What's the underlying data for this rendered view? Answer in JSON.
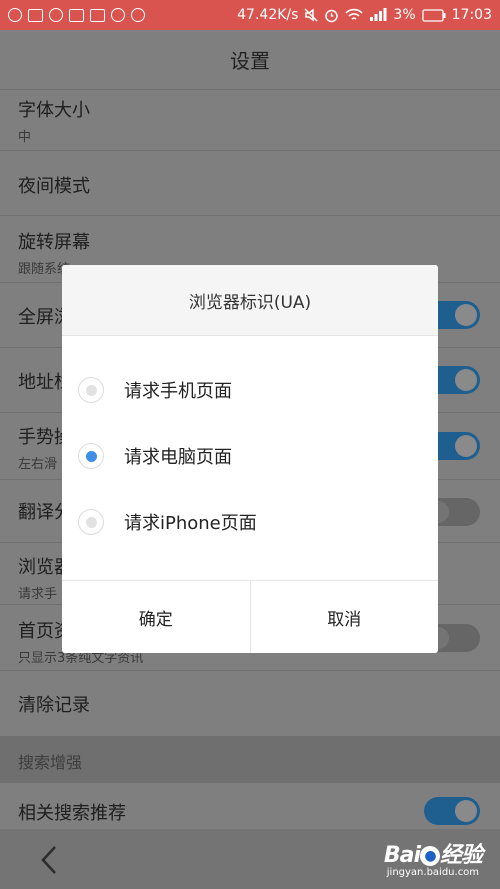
{
  "status_bar": {
    "speed": "47.42K/s",
    "battery": "3%",
    "time": "17:03",
    "color": "#d9534f"
  },
  "header": {
    "title": "设置"
  },
  "settings": {
    "font_size": {
      "title": "字体大小",
      "value": "中"
    },
    "night_mode": {
      "title": "夜间模式"
    },
    "rotate": {
      "title": "旋转屏幕",
      "value": "跟随系统"
    },
    "fullscreen": {
      "title": "全屏浏",
      "toggle": true
    },
    "address": {
      "title": "地址栏",
      "toggle": true
    },
    "gesture": {
      "title": "手势操",
      "value": "左右滑",
      "toggle": true
    },
    "translate": {
      "title": "翻译分",
      "toggle": false
    },
    "browser_ua": {
      "title": "浏览器",
      "value": "请求手"
    },
    "homepage": {
      "title": "首页资",
      "value": "只显示3条纯文字资讯",
      "toggle": false
    },
    "clear": {
      "title": "清除记录"
    },
    "section_search": {
      "title": "搜索增强"
    },
    "related": {
      "title": "相关搜索推荐",
      "toggle": true
    }
  },
  "dialog": {
    "title": "浏览器标识(UA)",
    "options": [
      {
        "label": "请求手机页面",
        "checked": false
      },
      {
        "label": "请求电脑页面",
        "checked": true
      },
      {
        "label": "请求iPhone页面",
        "checked": false
      }
    ],
    "confirm": "确定",
    "cancel": "取消",
    "accent": "#3d8ee6"
  },
  "watermark": {
    "logo_a": "Bai",
    "logo_b": "经验",
    "sub": "jingyan.baidu.com"
  }
}
